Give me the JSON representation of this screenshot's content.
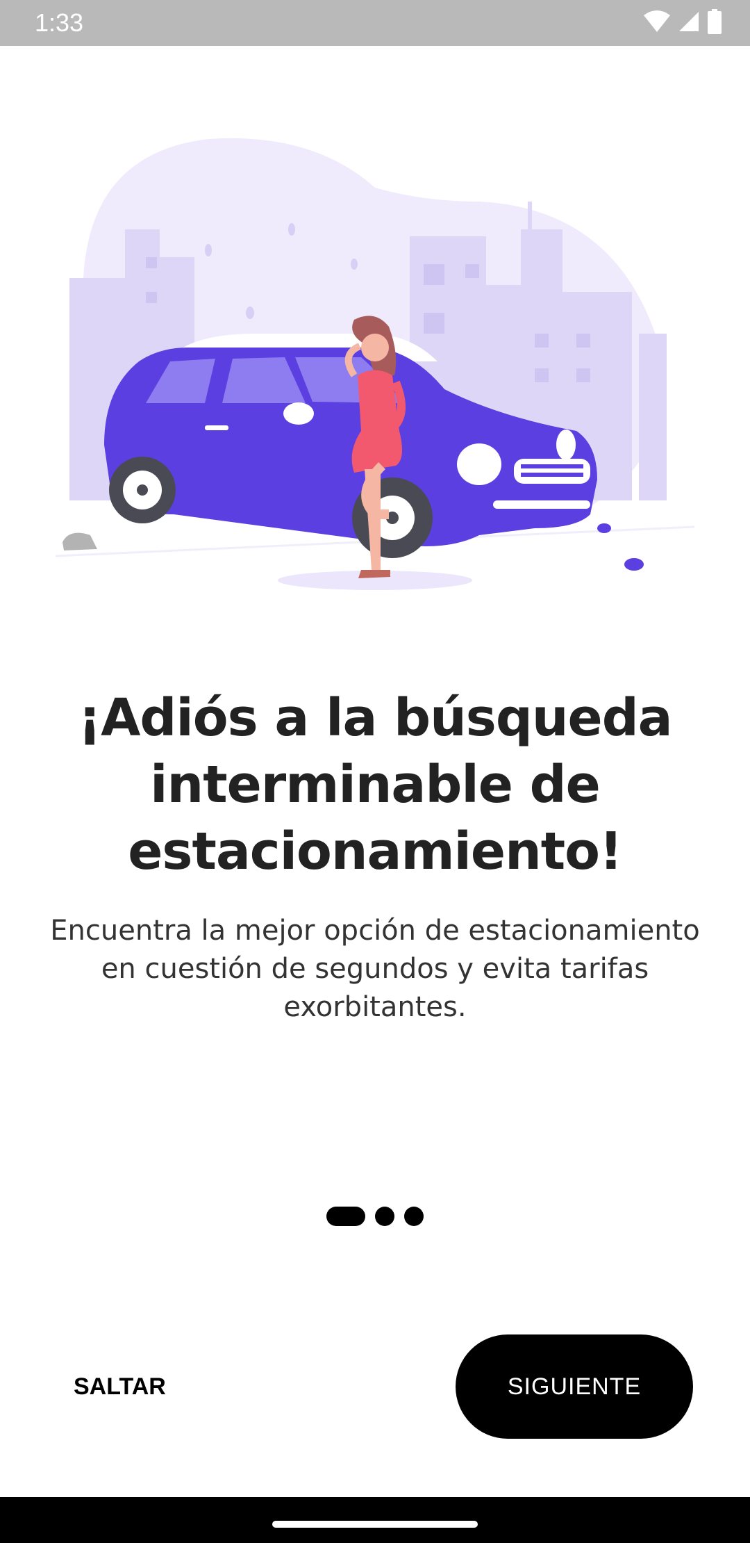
{
  "status_bar": {
    "time": "1:33",
    "icons": [
      "wifi-icon",
      "signal-icon",
      "battery-icon"
    ]
  },
  "onboarding": {
    "headline": "¡Adiós a la búsqueda interminable de estacionamiento!",
    "subtitle": "Encuentra la mejor opción de estacionamiento en cuestión de segundos y evita tarifas exorbitantes.",
    "pager": {
      "page_count": 3,
      "current_page": 1
    },
    "skip_label": "SALTAR",
    "next_label": "SIGUIENTE"
  },
  "colors": {
    "accent": "#5b3fe0",
    "blob": "#ede9fb",
    "buildings": "#ddd6f7",
    "dress": "#f2596f",
    "button_bg": "#000000",
    "button_text": "#ffffff"
  }
}
